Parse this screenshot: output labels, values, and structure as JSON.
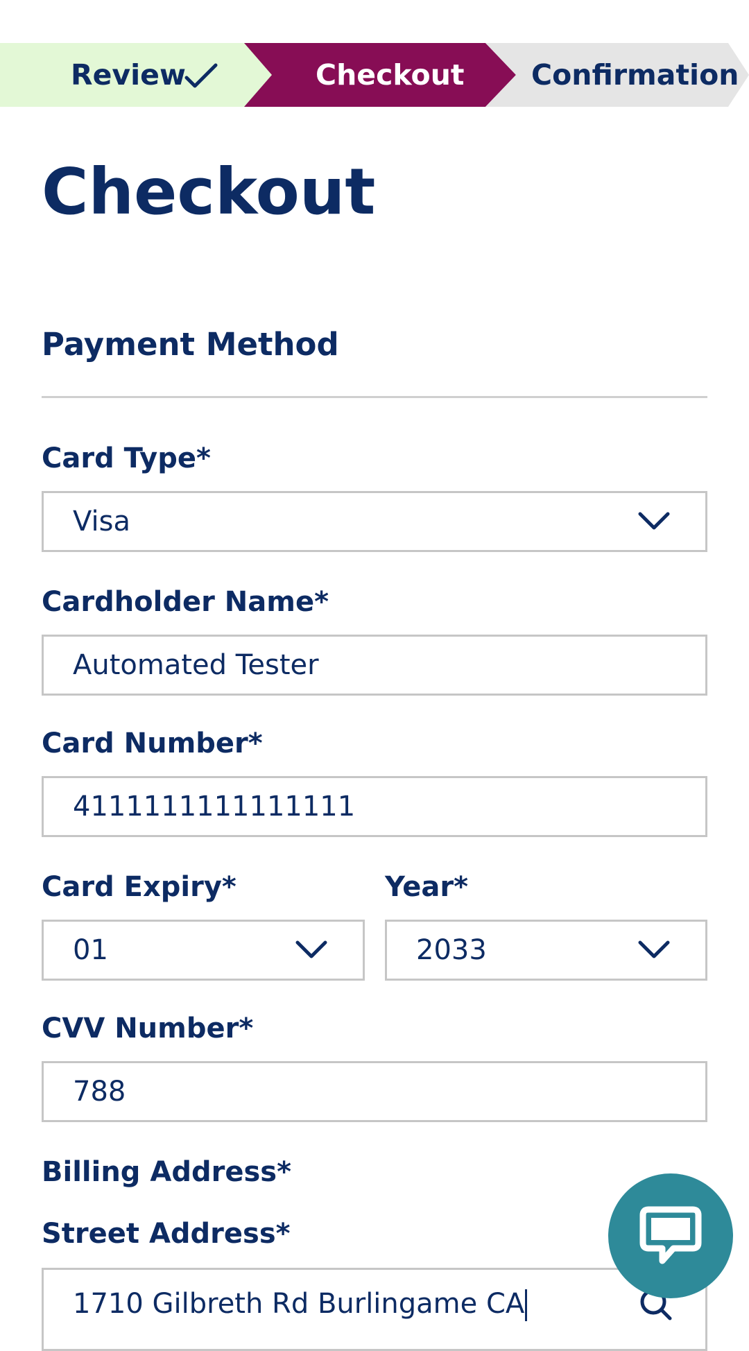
{
  "stepper": {
    "steps": [
      {
        "label": "Review",
        "state": "completed"
      },
      {
        "label": "Checkout",
        "state": "current"
      },
      {
        "label": "Confirmation",
        "state": "upcoming"
      }
    ],
    "colors": {
      "completed": "#e3f8d6",
      "current": "#870d55",
      "upcoming": "#e5e5e5"
    }
  },
  "page": {
    "title": "Checkout"
  },
  "payment": {
    "section_title": "Payment Method",
    "card_type": {
      "label": "Card Type*",
      "value": "Visa"
    },
    "cardholder_name": {
      "label": "Cardholder Name*",
      "value": "Automated Tester"
    },
    "card_number": {
      "label": "Card Number*",
      "value": "4111111111111111"
    },
    "card_expiry": {
      "label": "Card Expiry*",
      "value": "01"
    },
    "year": {
      "label": "Year*",
      "value": "2033"
    },
    "cvv": {
      "label": "CVV Number*",
      "value": "788"
    }
  },
  "billing": {
    "section_label": "Billing Address*",
    "street": {
      "label": "Street Address*",
      "value": "1710 Gilbreth Rd Burlingame CA"
    }
  },
  "icons": {
    "check": "check-icon",
    "chevron": "chevron-down-icon",
    "chat": "chat-bubble-icon",
    "search": "search-icon"
  },
  "colors": {
    "text": "#0d2b63",
    "accent": "#870d55",
    "chat": "#2e8a99",
    "border": "#c6c6c6"
  }
}
